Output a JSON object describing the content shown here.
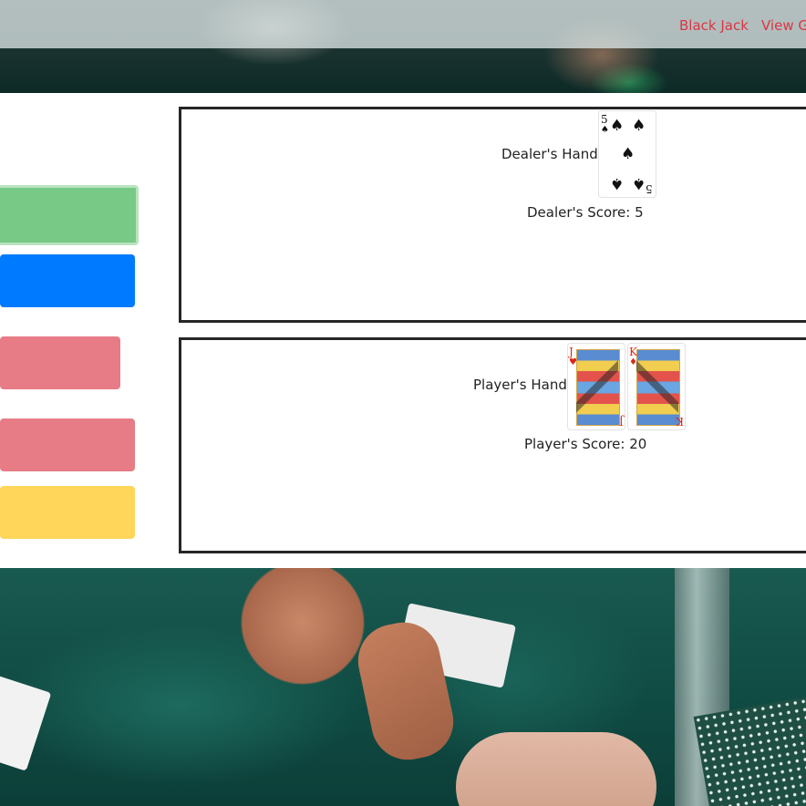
{
  "nav": {
    "links": [
      "Black Jack",
      "View G"
    ]
  },
  "dealer": {
    "hand_label": "Dealer's Hand:",
    "score_label": "Dealer's Score: 5",
    "cards": [
      {
        "rank": "5",
        "suit": "♠",
        "color": "#111111"
      }
    ]
  },
  "player": {
    "hand_label": "Player's Hand:",
    "score_label": "Player's Score: 20",
    "cards": [
      {
        "rank": "J",
        "suit": "♥",
        "color": "#d9291c"
      },
      {
        "rank": "K",
        "suit": "♦",
        "color": "#d9291c"
      }
    ]
  },
  "colors": {
    "nav_link": "#dc3545",
    "green_button": "#78c985",
    "blue_button": "#007bff",
    "red_button": "#e77c86",
    "yellow_button": "#ffd65a"
  }
}
